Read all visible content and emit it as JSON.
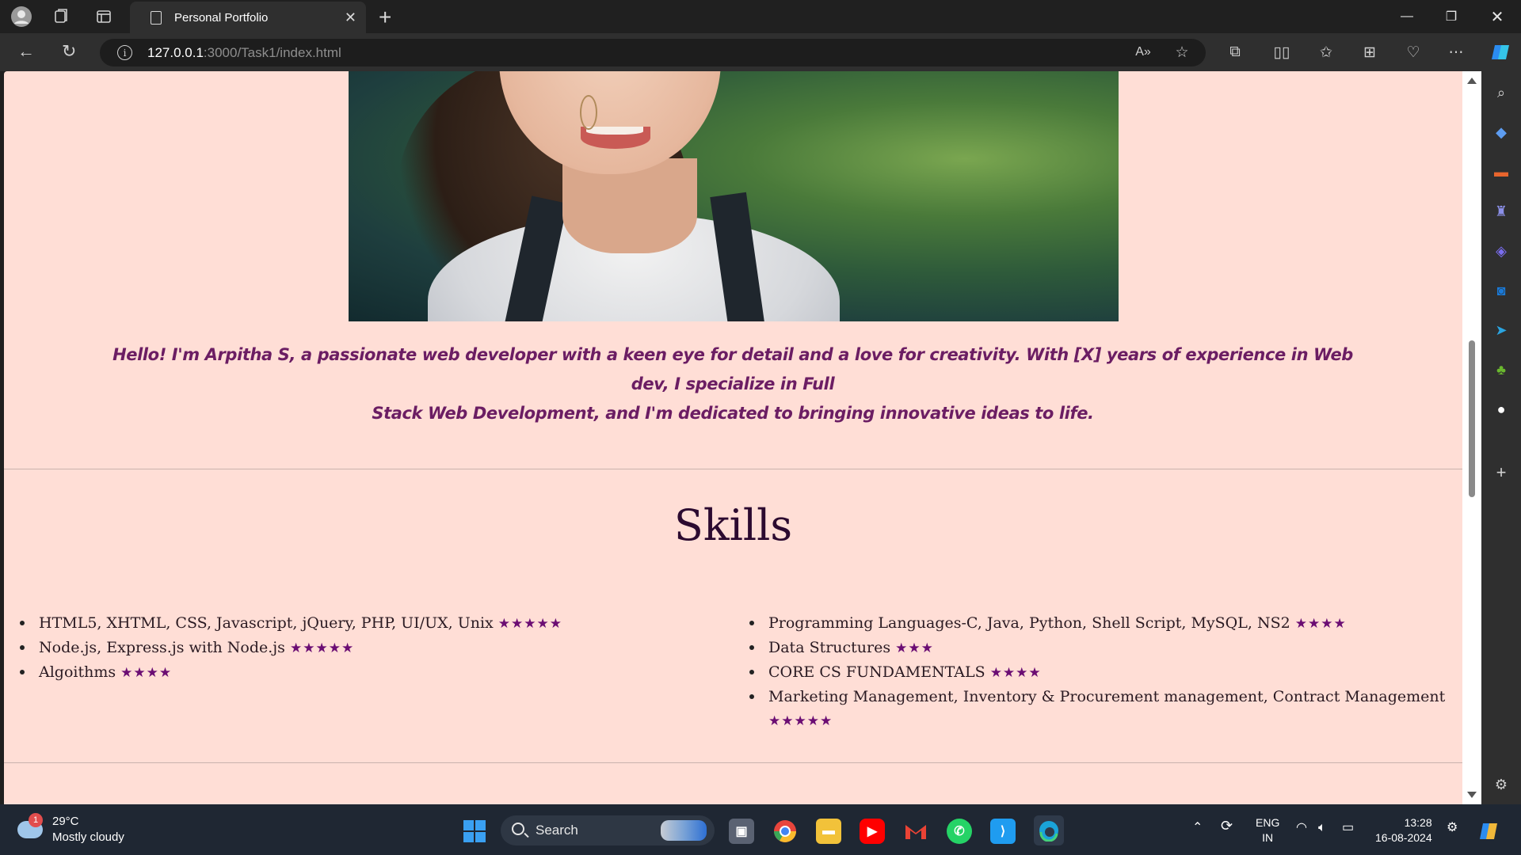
{
  "browser": {
    "tab_title": "Personal Portfolio",
    "url_host": "127.0.0.1",
    "url_rest": ":3000/Task1/index.html"
  },
  "page": {
    "intro_line1": "Hello! I'm Arpitha S, a passionate web developer with a keen eye for detail and a love for creativity. With [X] years of experience in Web dev, I specialize in Full",
    "intro_line2": "Stack Web Development, and I'm dedicated to bringing innovative ideas to life.",
    "skills_title": "Skills",
    "skills_left": [
      {
        "text": "HTML5, XHTML, CSS, Javascript, jQuery, PHP, UI/UX, Unix",
        "stars": "★★★★★"
      },
      {
        "text": "Node.js, Express.js with Node.js",
        "stars": "★★★★★"
      },
      {
        "text": "Algoithms",
        "stars": "★★★★"
      }
    ],
    "skills_right": [
      {
        "text": "Programming Languages-C, Java, Python, Shell Script, MySQL, NS2",
        "stars": "★★★★"
      },
      {
        "text": "Data Structures",
        "stars": "★★★"
      },
      {
        "text": "CORE CS FUNDAMENTALS",
        "stars": "★★★★"
      },
      {
        "text": "Marketing Management, Inventory & Procurement management, Contract Management",
        "stars": "★★★★★"
      }
    ]
  },
  "taskbar": {
    "weather_badge": "1",
    "temperature": "29°C",
    "weather_desc": "Mostly cloudy",
    "search_label": "Search",
    "lang_top": "ENG",
    "lang_bottom": "IN",
    "time": "13:28",
    "date": "16-08-2024"
  },
  "colors": {
    "page_bg": "#ffded6",
    "intro_text": "#6b1d63",
    "stars": "#6b0d73"
  }
}
